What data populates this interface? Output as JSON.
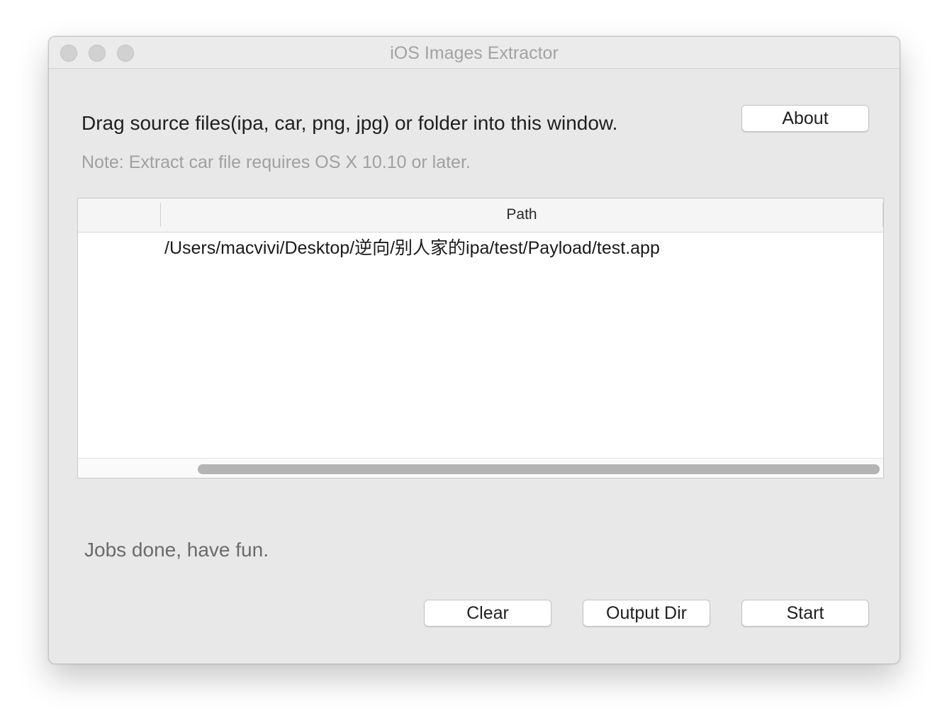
{
  "window": {
    "title": "iOS Images Extractor"
  },
  "instructions": {
    "main": "Drag source files(ipa, car, png, jpg) or folder into this window.",
    "note": "Note: Extract car file requires OS X 10.10 or later."
  },
  "buttons": {
    "about": "About",
    "clear": "Clear",
    "output_dir": "Output Dir",
    "start": "Start"
  },
  "table": {
    "columns": [
      "",
      "Path"
    ],
    "rows": [
      {
        "path": "/Users/macvivi/Desktop/逆向/别人家的ipa/test/Payload/test.app"
      }
    ]
  },
  "status": "Jobs done, have fun.",
  "icons": {
    "close": "close-icon",
    "minimize": "minimize-icon",
    "zoom": "zoom-icon"
  },
  "colors": {
    "window_bg": "#e8e8e8",
    "traffic_light_inactive": "#d1d1d1",
    "scroll_thumb": "#b4b4b4"
  }
}
